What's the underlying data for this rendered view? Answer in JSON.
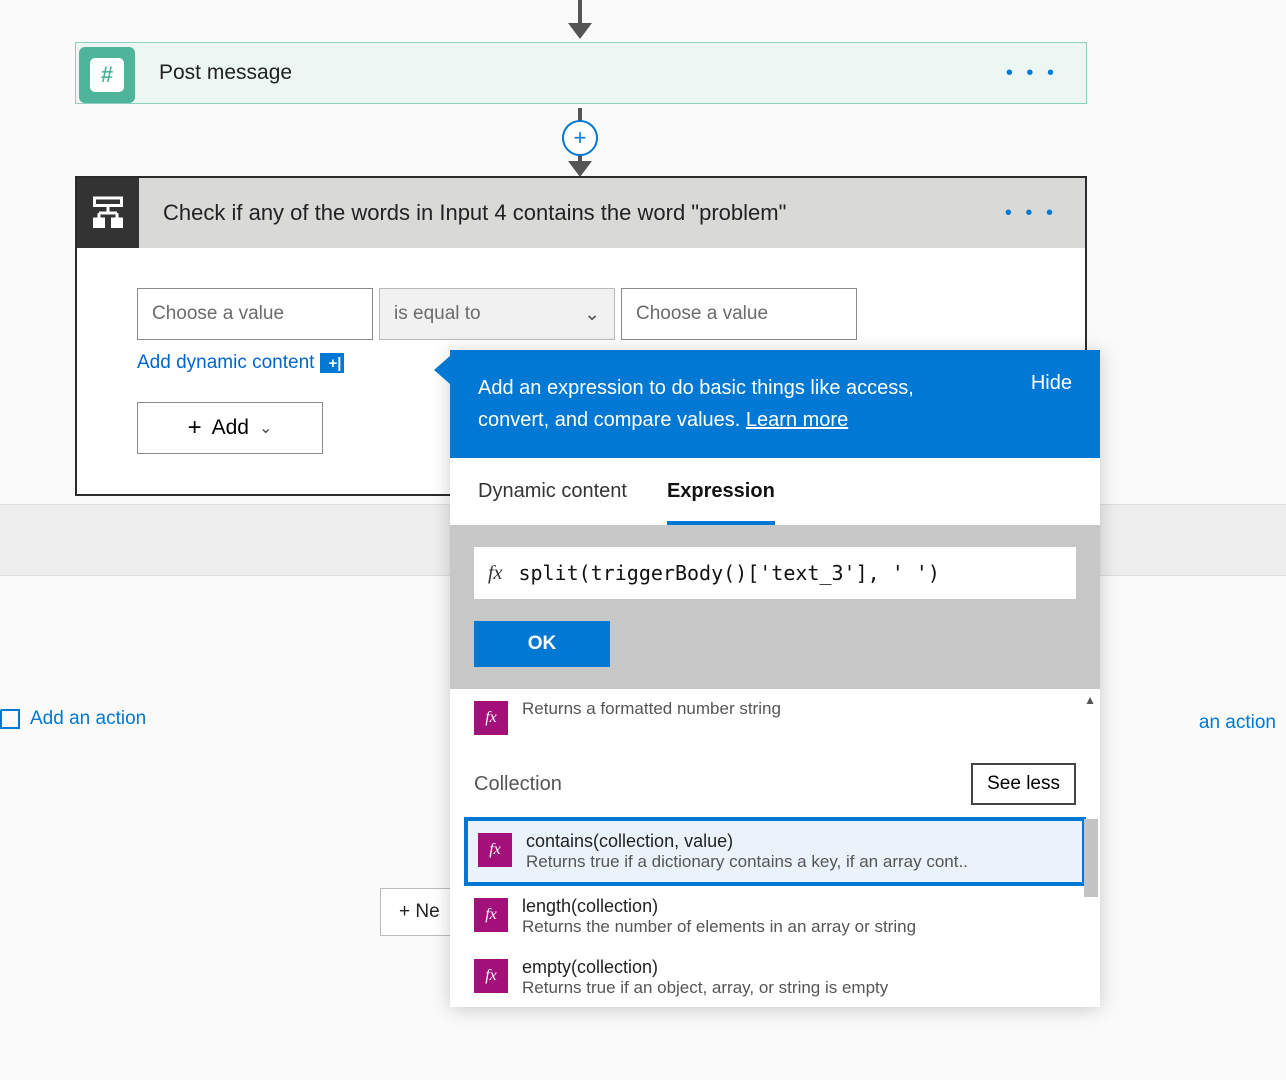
{
  "post_card": {
    "title": "Post message",
    "icon_char": "#"
  },
  "check_card": {
    "title": "Check if any of the words in Input 4 contains the word \"problem\"",
    "choose_value": "Choose a value",
    "operator": "is equal to",
    "dynamic_link": "Add dynamic content",
    "add_btn": "Add"
  },
  "add_action": "Add an action",
  "right_action_fragment": "an action",
  "new_step": "+ Ne",
  "popup": {
    "header_prefix": "Add an expression to do basic things like access, convert, and compare values. ",
    "learn_more": "Learn more",
    "hide": "Hide",
    "tabs": {
      "dynamic": "Dynamic content",
      "expression": "Expression"
    },
    "fx_label": "fx",
    "expression_value": "split(triggerBody()['text_3'], ' ')",
    "ok": "OK",
    "peek_desc": "Returns a formatted number string",
    "section_title": "Collection",
    "see_less": "See less",
    "functions": [
      {
        "name": "contains(collection, value)",
        "desc": "Returns true if a dictionary contains a key, if an array cont.."
      },
      {
        "name": "length(collection)",
        "desc": "Returns the number of elements in an array or string"
      },
      {
        "name": "empty(collection)",
        "desc": "Returns true if an object, array, or string is empty"
      }
    ]
  }
}
